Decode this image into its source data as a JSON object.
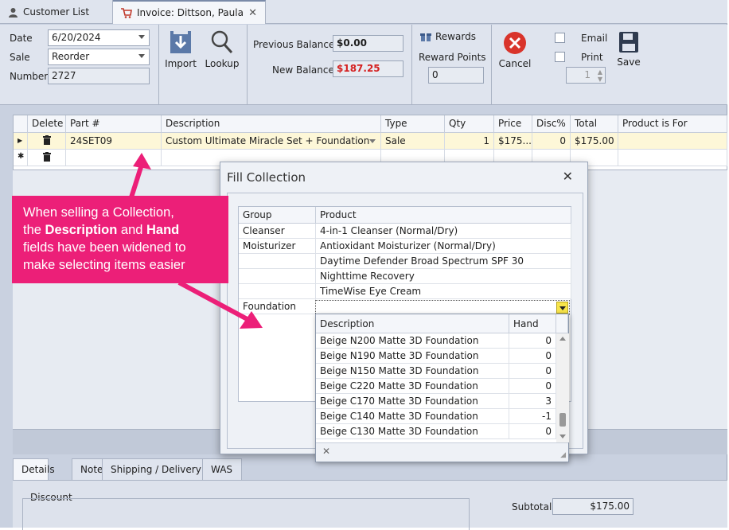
{
  "tabs": [
    {
      "label": "Customer List"
    },
    {
      "label": "Invoice: Dittson, Paula"
    }
  ],
  "toolbar": {
    "date_label": "Date",
    "date_value": "6/20/2024",
    "sale_label": "Sale",
    "sale_value": "Reorder",
    "number_label": "Number",
    "number_value": "2727",
    "import_label": "Import",
    "lookup_label": "Lookup",
    "prev_balance_label": "Previous Balance",
    "prev_balance_value": "$0.00",
    "new_balance_label": "New Balance",
    "new_balance_value": "$187.25",
    "rewards_label": "Rewards",
    "reward_points_label": "Reward Points",
    "reward_points_value": "0",
    "cancel_label": "Cancel",
    "email_label": "Email",
    "print_label": "Print",
    "copies_value": "1",
    "save_label": "Save"
  },
  "grid": {
    "headers": [
      "Delete",
      "Part #",
      "Description",
      "Type",
      "Qty",
      "Price",
      "Disc%",
      "Total",
      "Product is For"
    ],
    "row": {
      "part": "24SET09",
      "description": "Custom Ultimate Miracle Set + Foundation",
      "type": "Sale",
      "qty": "1",
      "price": "$175...",
      "disc": "0",
      "total": "$175.00",
      "for": ""
    }
  },
  "bottom_tabs": [
    "Details",
    "Note",
    "Shipping / Delivery",
    "WAS"
  ],
  "bottom": {
    "discount_label": "Discount",
    "subtotal_label": "Subtotal",
    "subtotal_value": "$175.00"
  },
  "dialog": {
    "title": "Fill Collection",
    "headers": [
      "Group",
      "Product"
    ],
    "rows": [
      {
        "group": "Cleanser",
        "product": "4-in-1 Cleanser (Normal/Dry)"
      },
      {
        "group": "Moisturizer",
        "product": "Antioxidant Moisturizer (Normal/Dry)"
      },
      {
        "group": "",
        "product": "Daytime Defender Broad Spectrum SPF 30"
      },
      {
        "group": "",
        "product": "Nighttime Recovery"
      },
      {
        "group": "",
        "product": "TimeWise Eye Cream"
      },
      {
        "group": "Foundation",
        "product": ""
      }
    ]
  },
  "dropdown": {
    "headers": [
      "Description",
      "Hand"
    ],
    "rows": [
      {
        "desc": "Beige N200 Matte 3D Foundation",
        "hand": "0"
      },
      {
        "desc": "Beige N190 Matte 3D Foundation",
        "hand": "0"
      },
      {
        "desc": "Beige N150 Matte 3D Foundation",
        "hand": "0"
      },
      {
        "desc": "Beige C220 Matte 3D Foundation",
        "hand": "0"
      },
      {
        "desc": "Beige C170 Matte 3D Foundation",
        "hand": "3"
      },
      {
        "desc": "Beige C140 Matte 3D Foundation",
        "hand": "-1"
      },
      {
        "desc": "Beige C130 Matte 3D Foundation",
        "hand": "0"
      }
    ]
  },
  "callout": {
    "line1": "When selling a Collection,",
    "line2a": "the ",
    "line2b": "Description",
    "line2c": " and ",
    "line2d": "Hand",
    "line3": "fields have been widened to",
    "line4": "make selecting items easier"
  },
  "colors": {
    "accent": "#ec1f78",
    "new_balance": "#d42020",
    "selected_row": "#fdf7d8"
  }
}
